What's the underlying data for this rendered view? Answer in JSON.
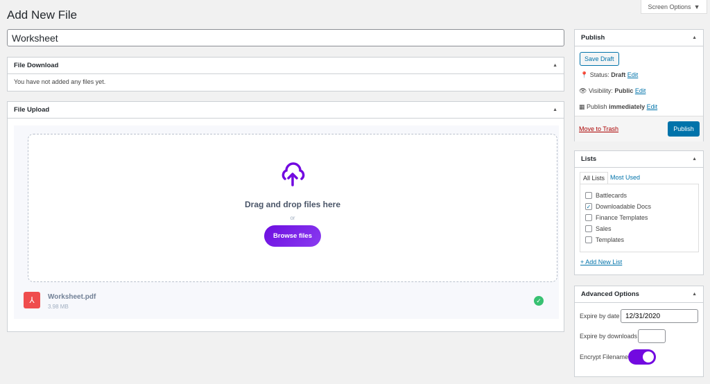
{
  "page": {
    "title": "Add New File",
    "screen_options": "Screen Options"
  },
  "post_title": "Worksheet",
  "file_download": {
    "title": "File Download",
    "empty": "You have not added any files yet."
  },
  "file_upload": {
    "title": "File Upload",
    "drop_text": "Drag and drop files here",
    "or": "or",
    "browse": "Browse files",
    "accent": "#7209e0",
    "file": {
      "name": "Worksheet.pdf",
      "size": "3.98 MB",
      "status": "complete"
    }
  },
  "publish": {
    "title": "Publish",
    "save_draft": "Save Draft",
    "status_label": "Status:",
    "status": "Draft",
    "visibility_label": "Visibility:",
    "visibility": "Public",
    "publish_label": "Publish",
    "publish_when": "immediately",
    "edit": "Edit",
    "trash": "Move to Trash",
    "publish_btn": "Publish"
  },
  "lists": {
    "title": "Lists",
    "tabs": [
      "All Lists",
      "Most Used"
    ],
    "items": [
      {
        "label": "Battlecards",
        "checked": false
      },
      {
        "label": "Downloadable Docs",
        "checked": true
      },
      {
        "label": "Finance Templates",
        "checked": false
      },
      {
        "label": "Sales",
        "checked": false
      },
      {
        "label": "Templates",
        "checked": false
      }
    ],
    "add": "+ Add New List"
  },
  "advanced": {
    "title": "Advanced Options",
    "expire_date_label": "Expire by date",
    "expire_date": "12/31/2020",
    "expire_downloads_label": "Expire by downloads",
    "expire_downloads": "",
    "encrypt_label": "Encrypt Filename",
    "encrypt_on": true
  }
}
